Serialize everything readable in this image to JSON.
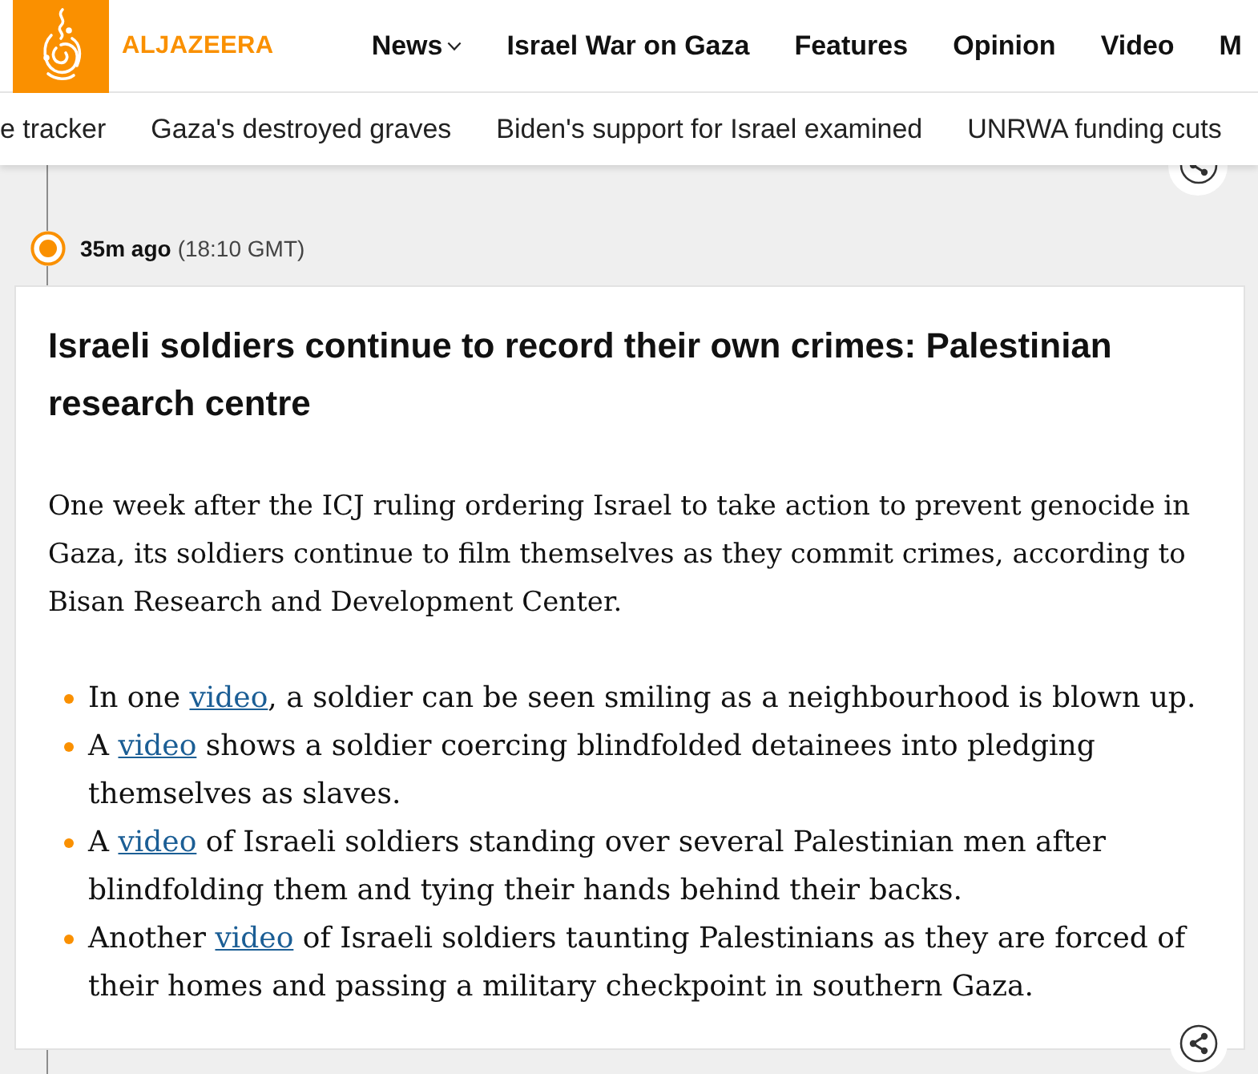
{
  "header": {
    "logo_text": "ALJAZEERA",
    "nav": [
      {
        "label": "News",
        "has_menu": true
      },
      {
        "label": "Israel War on Gaza",
        "has_menu": false
      },
      {
        "label": "Features",
        "has_menu": false
      },
      {
        "label": "Opinion",
        "has_menu": false
      },
      {
        "label": "Video",
        "has_menu": false
      },
      {
        "label": "M",
        "has_menu": false
      }
    ]
  },
  "topics": [
    "e tracker",
    "Gaza's destroyed graves",
    "Biden's support for Israel examined",
    "UNRWA funding cuts"
  ],
  "post": {
    "time_ago": "35m ago",
    "time": "(18:10 GMT)",
    "title": "Israeli soldiers continue to record their own crimes: Palestinian research centre",
    "intro": "One week after the ICJ ruling ordering Israel to take action to prevent genocide in Gaza, its soldiers continue to film themselves as they commit crimes, according to Bisan Research and Development Center.",
    "bullets": [
      {
        "before": "In one ",
        "link": "video",
        "after": ", a soldier can be seen smiling as a neighbourhood is blown up."
      },
      {
        "before": "A ",
        "link": "video",
        "after": " shows a soldier coercing blindfolded detainees into pledging themselves as slaves."
      },
      {
        "before": "A ",
        "link": "video",
        "after": " of Israeli soldiers standing over several Palestinian men after blindfolding them and tying their hands behind their backs."
      },
      {
        "before": "Another ",
        "link": "video",
        "after": " of Israeli soldiers taunting Palestinians as they are forced of their homes and passing a military checkpoint in southern Gaza."
      }
    ]
  }
}
